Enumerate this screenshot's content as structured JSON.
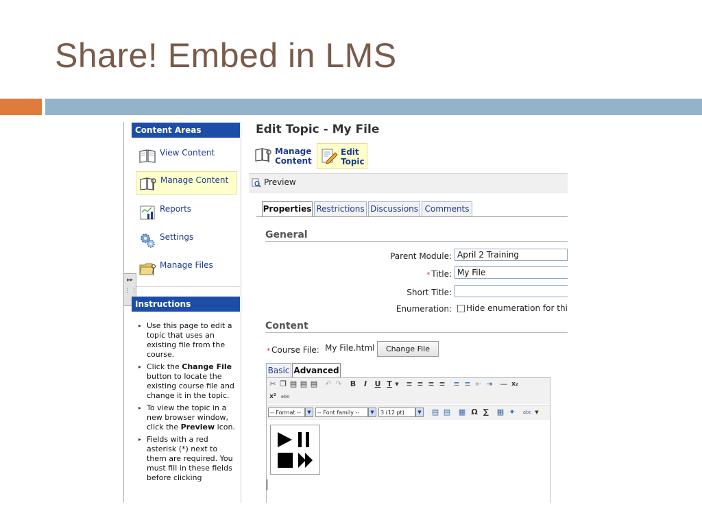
{
  "slide": {
    "title": "Share! Embed in LMS",
    "colors": {
      "title": "#7a5a4a",
      "accent_orange": "#e07b3b",
      "accent_blue": "#93b3cc"
    }
  },
  "sidebar": {
    "content_areas_title": "Content Areas",
    "items": [
      {
        "label": "View Content",
        "icon": "book-icon",
        "active": false
      },
      {
        "label": "Manage Content",
        "icon": "manage-content-icon",
        "active": true
      },
      {
        "label": "Reports",
        "icon": "chart-icon",
        "active": false
      },
      {
        "label": "Settings",
        "icon": "gears-icon",
        "active": false
      },
      {
        "label": "Manage Files",
        "icon": "folder-icon",
        "active": false
      }
    ],
    "toggle_glyph": "▸▸",
    "instructions_title": "Instructions",
    "instructions": [
      {
        "before": "Use this page to edit a topic that uses an existing file from the course.",
        "bold": "",
        "after": ""
      },
      {
        "before": "Click the ",
        "bold": "Change File",
        "after": " button to locate the existing course file and change it in the topic."
      },
      {
        "before": "To view the topic in a new browser window, click the ",
        "bold": "Preview",
        "after": " icon."
      },
      {
        "before": "Fields with a red asterisk (*) next to them are required. You must fill in these fields before clicking",
        "bold": "",
        "after": ""
      }
    ]
  },
  "main": {
    "title": "Edit Topic - My File",
    "toolbar": {
      "manage_line1": "Manage",
      "manage_line2": "Content",
      "edit_line1": "Edit",
      "edit_line2": "Topic"
    },
    "preview_label": "Preview",
    "tabs": [
      "Properties",
      "Restrictions",
      "Discussions",
      "Comments"
    ],
    "active_tab": "Properties",
    "general_heading": "General",
    "form": {
      "parent_module_label": "Parent Module:",
      "parent_module_value": "April 2 Training",
      "required_mark": "*",
      "title_label": "Title:",
      "title_value": "My File",
      "short_title_label": "Short Title:",
      "short_title_value": "",
      "enumeration_label": "Enumeration:",
      "enumeration_option": "Hide enumeration for this topic",
      "enumeration_checked": false
    },
    "content_heading": "Content",
    "course_file": {
      "label": "Course File:",
      "value": "My File.html",
      "button": "Change File"
    },
    "editor": {
      "tabs": [
        "Basic",
        "Advanced"
      ],
      "active_tab": "Advanced",
      "format_select": "-- Format --",
      "font_select": "-- Font family --",
      "size_select": "3 (12 pt)",
      "bold": "B",
      "italic": "I",
      "underline": "U",
      "text_color": "T",
      "omega": "Ω",
      "sigma": "∑",
      "superscript": "x²",
      "subscript": "x₂",
      "strike": "abc",
      "spell": "abc"
    }
  }
}
